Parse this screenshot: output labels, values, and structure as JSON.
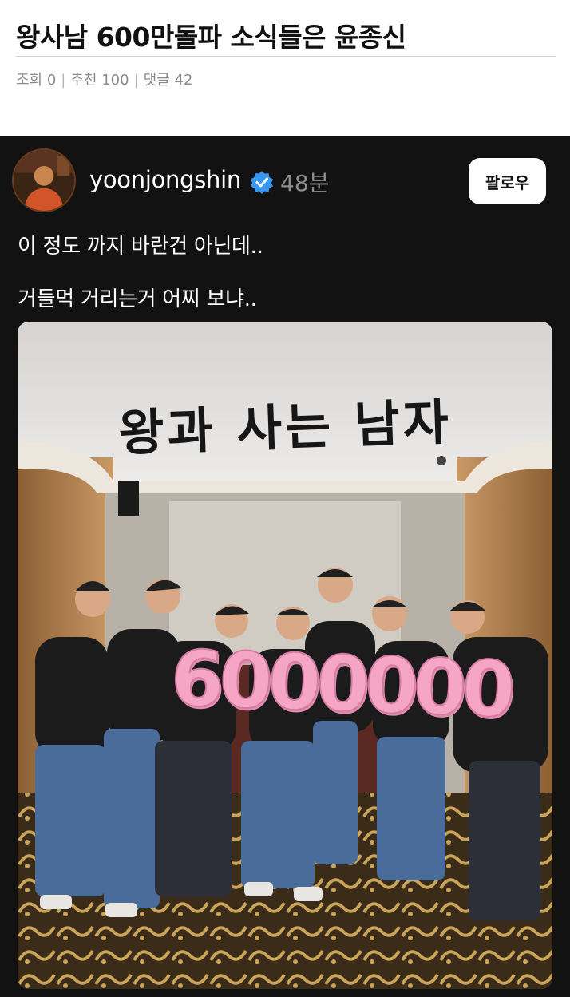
{
  "article": {
    "title": "왕사남 600만돌파 소식들은 윤종신",
    "views_label": "조회 0",
    "recommend_label": "추천 100",
    "comments_label": "댓글 42",
    "separator": "|"
  },
  "post": {
    "username": "yoonjongshin",
    "time": "48분",
    "follow_label": "팔로우",
    "lines": [
      "이 정도 까지 바란건 아닌데..",
      "거들먹 거리는거 어찌 보냐.."
    ],
    "photo": {
      "sign_text": "왕과 사는 남자",
      "balloon_text": "6000000"
    }
  },
  "colors": {
    "card_bg": "#121212",
    "verified": "#3897f0",
    "balloon_pink": "#f4a6c4"
  },
  "icons": [
    "verified-badge-icon"
  ]
}
